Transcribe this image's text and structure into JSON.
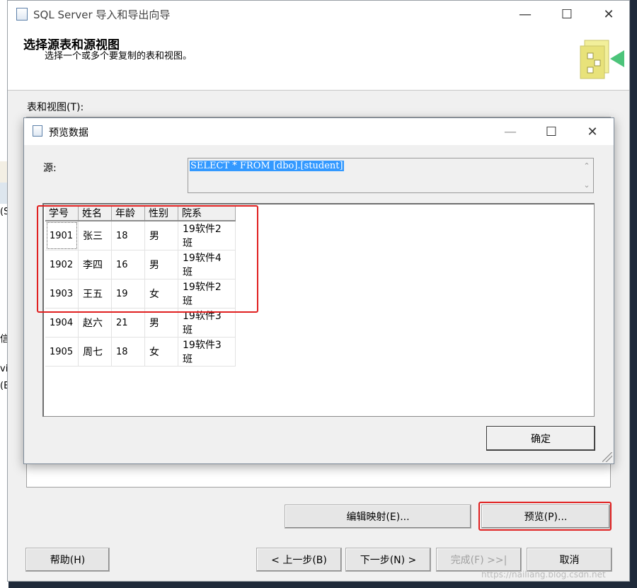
{
  "background": {
    "fragments": [
      "(S",
      "信",
      "vi",
      "(E"
    ]
  },
  "wizard": {
    "title": "SQL Server 导入和导出向导",
    "header_title": "选择源表和源视图",
    "header_subtitle": "选择一个或多个要复制的表和视图。",
    "tables_label": "表和视图(T):",
    "buttons": {
      "edit_mappings": "编辑映射(E)...",
      "preview": "预览(P)...",
      "help": "帮助(H)",
      "back": "< 上一步(B)",
      "next": "下一步(N) >",
      "finish": "完成(F) >>|",
      "cancel": "取消"
    }
  },
  "preview_dialog": {
    "title": "预览数据",
    "source_label": "源:",
    "sql": "SELECT * FROM [dbo].[student]",
    "columns": [
      "学号",
      "姓名",
      "年龄",
      "性别",
      "院系"
    ],
    "rows": [
      [
        "1901",
        "张三",
        "18",
        "男",
        "19软件2班"
      ],
      [
        "1902",
        "李四",
        "16",
        "男",
        "19软件4班"
      ],
      [
        "1903",
        "王五",
        "19",
        "女",
        "19软件2班"
      ],
      [
        "1904",
        "赵六",
        "21",
        "男",
        "19软件3班"
      ],
      [
        "1905",
        "周七",
        "18",
        "女",
        "19软件3班"
      ]
    ],
    "ok_button": "确定"
  },
  "watermark": "https://nailiang.blog.csdn.net",
  "colors": {
    "selection": "#3399ff",
    "highlight_box": "#e02020",
    "window_bg": "#f0f0f0"
  }
}
